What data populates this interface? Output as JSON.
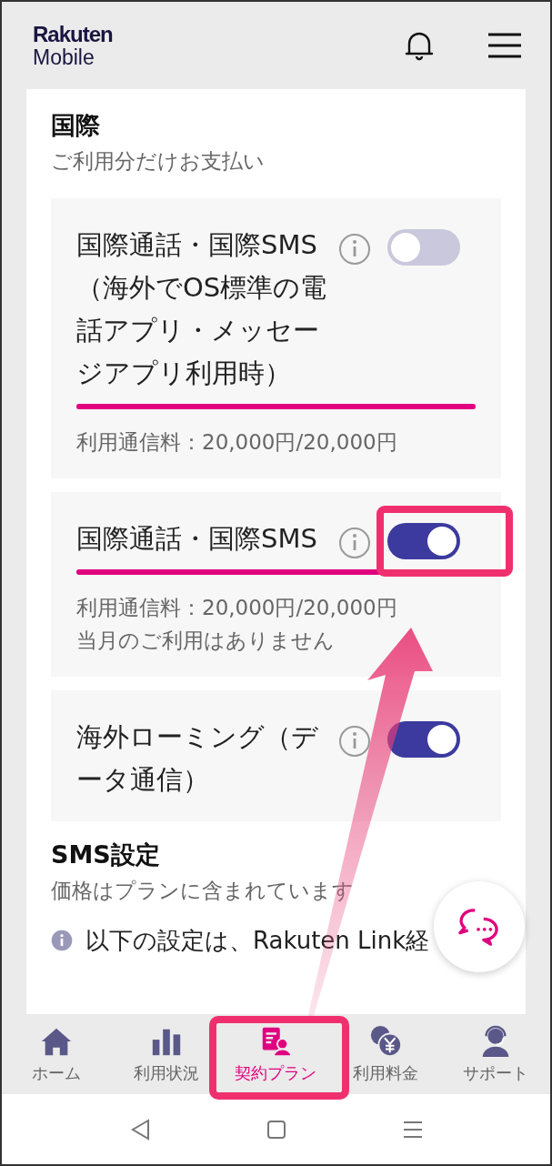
{
  "header": {
    "logo": {
      "line_1": "Rakuten",
      "line_2": "Mobile"
    }
  },
  "sections": [
    {
      "title": "国際",
      "subtitle": "ご利用分だけお支払い",
      "settings": [
        {
          "label": "国際通話・国際SMS（海外でOS標準の電話アプリ・メッセージアプリ利用時）",
          "on": false,
          "usage": {
            "level": 1
          },
          "notes": [
            "利用通信料：20,000円/20,000円"
          ]
        },
        {
          "label": "国際通話・国際SMS",
          "on": true,
          "usage": {
            "level": 1
          },
          "notes": [
            "利用通信料：20,000円/20,000円",
            "当月のご利用はありません"
          ]
        },
        {
          "label": "海外ローミング（データ通信）",
          "on": true
        }
      ]
    },
    {
      "title": "SMS設定",
      "subtitle": "価格はプランに含まれています",
      "info": "以下の設定は、Rakuten Link経"
    }
  ],
  "bottom_nav": [
    {
      "label": "ホーム",
      "kind": "home",
      "selected": false
    },
    {
      "label": "利用状況",
      "kind": "usage",
      "selected": false
    },
    {
      "label": "契約プラン",
      "kind": "plan",
      "selected": true
    },
    {
      "label": "利用料金",
      "kind": "fee",
      "selected": false
    },
    {
      "label": "サポート",
      "kind": "support",
      "selected": false
    }
  ]
}
